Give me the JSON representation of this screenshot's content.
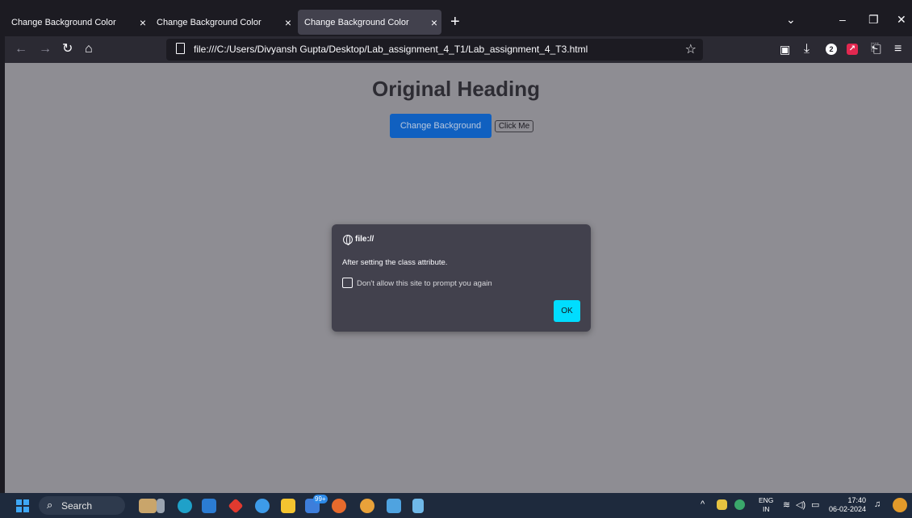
{
  "browser": {
    "tabs": [
      {
        "title": "Change Background Color",
        "active": false
      },
      {
        "title": "Change Background Color",
        "active": false
      },
      {
        "title": "Change Background Color",
        "active": true
      }
    ],
    "close_glyph": "×",
    "new_tab_glyph": "+",
    "url": "file:///C:/Users/Divyansh Gupta/Desktop/Lab_assignment_4_T1/Lab_assignment_4_T3.html",
    "notification_count": "2"
  },
  "page": {
    "heading": "Original Heading",
    "change_background_button": "Change Background",
    "click_me_button": "Click Me",
    "background_color": "#8e8d93"
  },
  "dialog": {
    "origin": "file://",
    "message": "After setting the class attribute.",
    "checkbox_label": "Don't allow this site to prompt you again",
    "ok_label": "OK"
  },
  "taskbar": {
    "search_label": "Search",
    "icon_badge": "99+",
    "language_top": "ENG",
    "language_bottom": "IN",
    "time": "17:40",
    "date": "06-02-2024"
  }
}
